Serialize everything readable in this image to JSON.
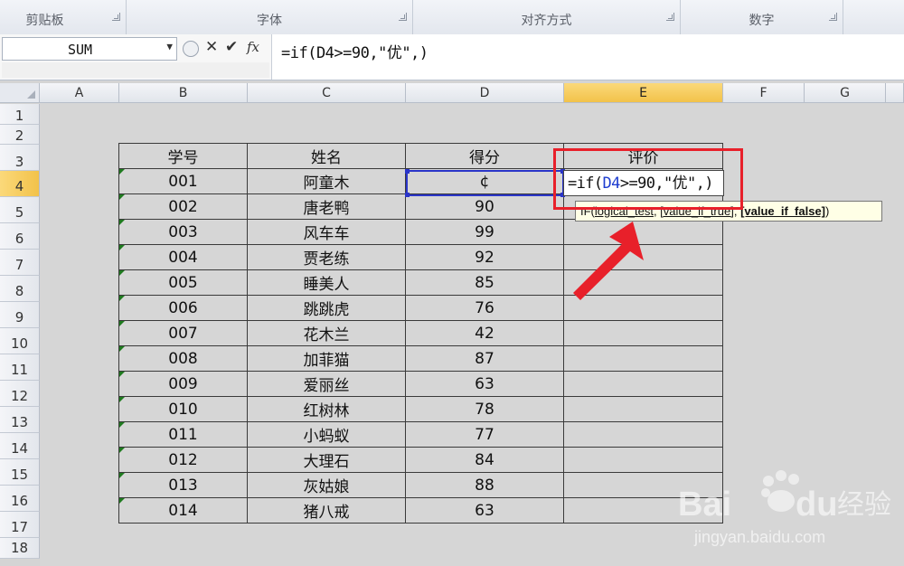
{
  "ribbon": {
    "groups": [
      "剪贴板",
      "字体",
      "对齐方式",
      "数字"
    ]
  },
  "formula_bar": {
    "name_box": "SUM",
    "cancel_icon": "✕",
    "enter_icon": "✔",
    "fx_label": "fx",
    "formula": "=if(D4>=90,\"优\",)"
  },
  "columns": [
    "A",
    "B",
    "C",
    "D",
    "E",
    "F",
    "G"
  ],
  "selected_column": "E",
  "rows": [
    "1",
    "2",
    "3",
    "4",
    "5",
    "6",
    "7",
    "8",
    "9",
    "10",
    "11",
    "12",
    "13",
    "14",
    "15",
    "16",
    "17",
    "18"
  ],
  "selected_row": "4",
  "table": {
    "headers": [
      "学号",
      "姓名",
      "得分",
      "评价"
    ],
    "rows": [
      [
        "001",
        "阿童木",
        "¢",
        ""
      ],
      [
        "002",
        "唐老鸭",
        "90",
        ""
      ],
      [
        "003",
        "风车车",
        "99",
        ""
      ],
      [
        "004",
        "贾老练",
        "92",
        ""
      ],
      [
        "005",
        "睡美人",
        "85",
        ""
      ],
      [
        "006",
        "跳跳虎",
        "76",
        ""
      ],
      [
        "007",
        "花木兰",
        "42",
        ""
      ],
      [
        "008",
        "加菲猫",
        "87",
        ""
      ],
      [
        "009",
        "爱丽丝",
        "63",
        ""
      ],
      [
        "010",
        "红树林",
        "78",
        ""
      ],
      [
        "011",
        "小蚂蚁",
        "77",
        ""
      ],
      [
        "012",
        "大理石",
        "84",
        ""
      ],
      [
        "013",
        "灰姑娘",
        "88",
        ""
      ],
      [
        "014",
        "猪八戒",
        "63",
        ""
      ]
    ]
  },
  "in_cell_edit": {
    "prefix": "=if(",
    "ref": "D4",
    "suffix": ">=90,\"优\",)"
  },
  "tooltip": {
    "fn": "IF(",
    "arg1": "logical_test",
    "arg2": "[value_if_true]",
    "arg3": "[value_if_false]",
    "close": ")"
  },
  "watermark": {
    "brand": "Bai",
    "brand2": "du",
    "cn": "经验",
    "url": "jingyan.baidu.com"
  },
  "colors": {
    "accent_red": "#e8202a",
    "selection_blue": "#2a35c9",
    "header_selected": "#f2c24a"
  }
}
